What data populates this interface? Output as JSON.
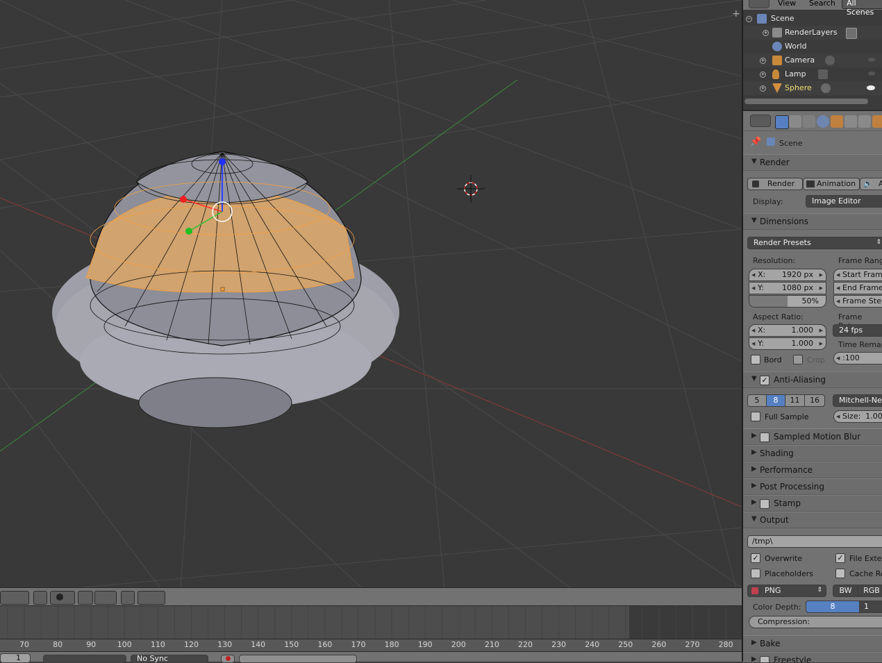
{
  "outliner": {
    "menu": [
      "View",
      "Search"
    ],
    "filter": "All Scenes",
    "rows": [
      {
        "label": "Scene",
        "icon": "scene-icon"
      },
      {
        "label": "RenderLayers",
        "icon": "render-layers-icon"
      },
      {
        "label": "World",
        "icon": "world-icon"
      },
      {
        "label": "Camera",
        "icon": "camera-icon"
      },
      {
        "label": "Lamp",
        "icon": "lamp-icon"
      },
      {
        "label": "Sphere",
        "icon": "mesh-icon"
      }
    ]
  },
  "properties": {
    "breadcrumb": "Scene",
    "render": {
      "title": "Render",
      "buttons": {
        "render": "Render",
        "animation": "Animation",
        "audio": "A"
      },
      "display_label": "Display:",
      "display_value": "Image Editor"
    },
    "dimensions": {
      "title": "Dimensions",
      "presets": "Render Presets",
      "resolution_label": "Resolution:",
      "res_x_label": "X:",
      "res_x": "1920 px",
      "res_y_label": "Y:",
      "res_y": "1080 px",
      "res_pct": "50%",
      "res_pct_fill": 0.5,
      "frame_range_label": "Frame Range",
      "start_frame": "Start Frame",
      "end_frame": "End Frame:",
      "frame_step": "Frame Step",
      "aspect_label": "Aspect Ratio:",
      "asp_x_label": "X:",
      "asp_x": "1.000",
      "asp_y_label": "Y:",
      "asp_y": "1.000",
      "frame_rate_label": "Frame Rate:",
      "frame_rate": "24 fps",
      "time_remap_label": "Time Remap",
      "time_remap": ":100",
      "bord": "Bord",
      "crop": "Crop"
    },
    "anti_aliasing": {
      "title": "Anti-Aliasing",
      "samples": [
        "5",
        "8",
        "11",
        "16"
      ],
      "selected": "8",
      "filter": "Mitchell-Netr",
      "full_sample": "Full Sample",
      "size": "Size:  1.00"
    },
    "collapsed": [
      "Sampled Motion Blur",
      "Shading",
      "Performance",
      "Post Processing",
      "Stamp"
    ],
    "output": {
      "title": "Output",
      "path": "/tmp\\",
      "overwrite": "Overwrite",
      "file_ext": "File Exten",
      "placeholders": "Placeholders",
      "cache": "Cache Re",
      "format": "PNG",
      "bw": "BW",
      "rgb": "RGB",
      "color_depth_label": "Color Depth:",
      "color_depth": "8",
      "color_depth_2": "1",
      "compression": "Compression:"
    },
    "bake": "Bake",
    "freestyle": "Freestyle"
  },
  "timeline": {
    "ticks": [
      "70",
      "80",
      "90",
      "100",
      "110",
      "120",
      "130",
      "140",
      "150",
      "160",
      "170",
      "180",
      "190",
      "200",
      "210",
      "220",
      "230",
      "240",
      "250",
      "260",
      "270",
      "280"
    ],
    "frame": "1",
    "sync": "No Sync"
  }
}
